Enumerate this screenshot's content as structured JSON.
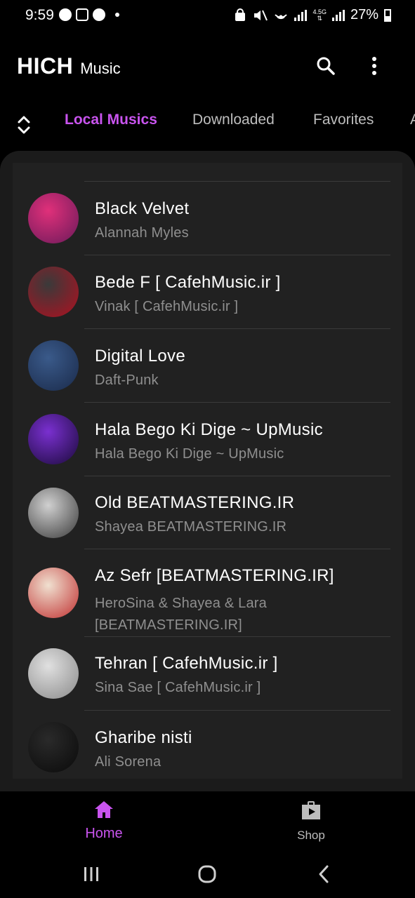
{
  "status_bar": {
    "time": "9:59",
    "network": "4.5G",
    "battery": "27%"
  },
  "header": {
    "brand_main": "HICH",
    "brand_sub": "Music",
    "icons": [
      "search-icon",
      "more-vert-icon"
    ]
  },
  "tabs": [
    {
      "label": "Local Musics",
      "active": true
    },
    {
      "label": "Downloaded",
      "active": false
    },
    {
      "label": "Favorites",
      "active": false
    },
    {
      "label": "A",
      "active": false
    }
  ],
  "tracks": [
    {
      "title": "Black Velvet",
      "artist": "Alannah Myles",
      "cover_colors": [
        "#e0307a",
        "#6a1a5a"
      ]
    },
    {
      "title": "Bede F  [ CafehMusic.ir ]",
      "artist": "Vinak [ CafehMusic.ir ]",
      "cover_colors": [
        "#3a3a3a",
        "#b01020"
      ]
    },
    {
      "title": "Digital Love",
      "artist": "Daft-Punk",
      "cover_colors": [
        "#3a5a8a",
        "#1a2a4a"
      ]
    },
    {
      "title": "Hala Bego Ki Dige  ~ UpMusic",
      "artist": "Hala Bego Ki Dige ~ UpMusic",
      "cover_colors": [
        "#7a30d0",
        "#1a0a3a"
      ]
    },
    {
      "title": "Old  BEATMASTERING.IR",
      "artist": "Shayea BEATMASTERING.IR",
      "cover_colors": [
        "#d0d0d0",
        "#3a3a3a"
      ]
    },
    {
      "title": "Az Sefr  [BEATMASTERING.IR]",
      "artist": "HeroSina & Shayea & Lara [BEATMASTERING.IR]",
      "cover_colors": [
        "#f0e0d0",
        "#c03030"
      ]
    },
    {
      "title": "Tehran [ CafehMusic.ir ]",
      "artist": "Sina Sae [ CafehMusic.ir ]",
      "cover_colors": [
        "#e0e0e0",
        "#8a8a8a"
      ]
    },
    {
      "title": "Gharibe nisti",
      "artist": "Ali Sorena",
      "cover_colors": [
        "#2a2a2a",
        "#0a0a0a"
      ]
    }
  ],
  "bottom_nav": {
    "home_label": "Home",
    "shop_label": "Shop"
  },
  "colors": {
    "accent": "#c954ef",
    "background": "#000000",
    "list_background": "#212121",
    "secondary_text": "#8f8f8f"
  }
}
